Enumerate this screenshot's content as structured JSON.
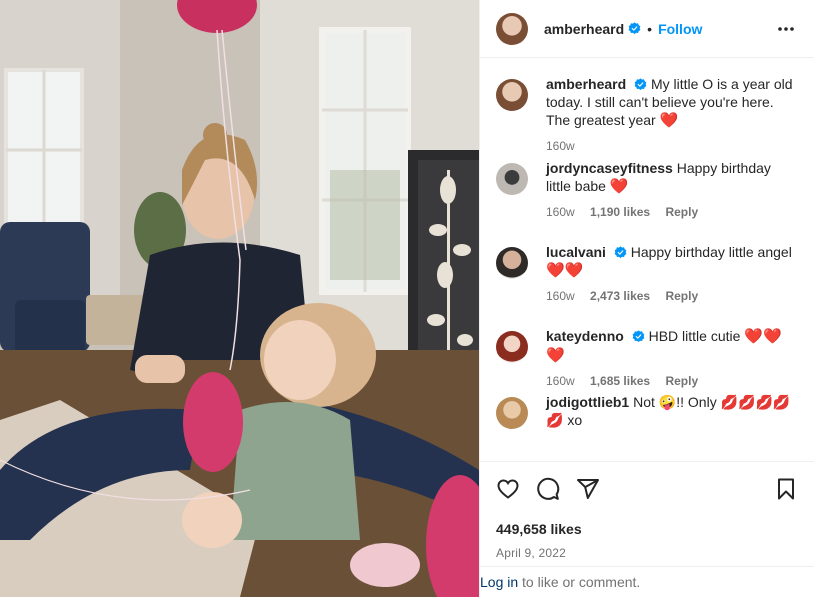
{
  "post": {
    "author": "amberheard",
    "follow_label": "Follow",
    "dot": "•"
  },
  "comments": [
    {
      "username": "amberheard",
      "verified": true,
      "text": "My little O is a year old today. I still can't believe you're here. The greatest year",
      "emoji": "❤️",
      "time": "160w",
      "likes": "",
      "reply": ""
    },
    {
      "username": "jordyncaseyfitness",
      "verified": false,
      "text": "Happy birthday little babe",
      "emoji": "❤️",
      "time": "160w",
      "likes": "1,190 likes",
      "reply": "Reply"
    },
    {
      "username": "lucalvani",
      "verified": true,
      "text": "Happy birthday little angel",
      "emoji": "❤️❤️",
      "time": "160w",
      "likes": "2,473 likes",
      "reply": "Reply"
    },
    {
      "username": "kateydenno",
      "verified": true,
      "text": "HBD little cutie",
      "emoji": "❤️❤️❤️",
      "time": "160w",
      "likes": "1,685 likes",
      "reply": "Reply"
    },
    {
      "username": "jodigottlieb1",
      "verified": false,
      "text_before": "Not",
      "emoji_face": "🤪",
      "text_after": "!! Only",
      "emoji_tail": "💋💋💋💋💋",
      "text_end": "xo"
    }
  ],
  "actions": {
    "like_icon": "heart-icon",
    "comment_icon": "comment-icon",
    "share_icon": "share-icon",
    "save_icon": "bookmark-icon"
  },
  "stats": {
    "likes": "449,658 likes",
    "date": "April 9, 2022"
  },
  "login": {
    "link": "Log in",
    "rest": " to like or comment."
  },
  "colors": {
    "accent": "#0095f6",
    "verified": "#0095f6",
    "heart": "#ed4956",
    "muted": "#737373"
  }
}
